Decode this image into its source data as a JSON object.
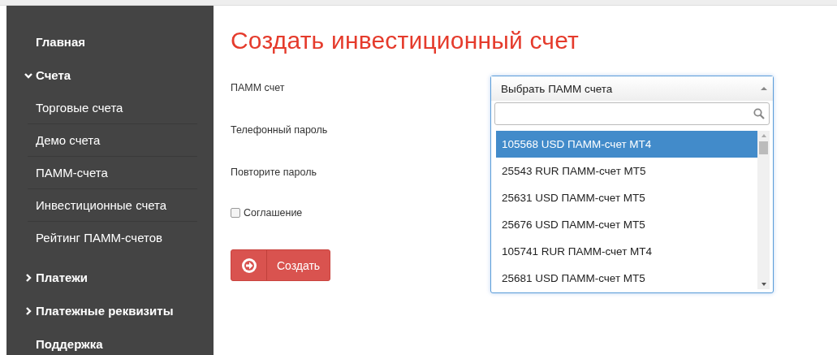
{
  "sidebar": {
    "items": [
      {
        "label": "Главная",
        "bold": true
      },
      {
        "label": "Счета",
        "bold": true,
        "expanded": true,
        "children": [
          {
            "label": "Торговые счета"
          },
          {
            "label": "Демо счета"
          },
          {
            "label": "ПАММ-счета"
          },
          {
            "label": "Инвестиционные счета"
          },
          {
            "label": "Рейтинг ПАММ-счетов"
          }
        ]
      },
      {
        "label": "Платежи",
        "bold": true,
        "expanded": false
      },
      {
        "label": "Платежные реквизиты",
        "bold": true,
        "expanded": false
      },
      {
        "label": "Поддержка",
        "bold": true
      }
    ]
  },
  "form": {
    "title": "Создать инвестиционный счет",
    "fields": [
      {
        "label": "ПАММ счет"
      },
      {
        "label": "Телефонный пароль"
      },
      {
        "label": "Повторите пароль"
      }
    ],
    "agreement": {
      "label": "Соглашение",
      "checked": false
    },
    "submit": "Создать",
    "dropdown": {
      "value": "Выбрать ПАММ счета",
      "expanded": true,
      "options": [
        {
          "label": "105568 USD ПАММ-счет MT4",
          "selected": true
        },
        {
          "label": "25543 RUR ПАММ-счет MT5",
          "selected": false
        },
        {
          "label": "25631 USD ПАММ-счет MT5",
          "selected": false
        },
        {
          "label": "25676 USD ПАММ-счет MT5",
          "selected": false
        },
        {
          "label": "105741 RUR ПАММ-счет MT4",
          "selected": false
        },
        {
          "label": "25681 USD ПАММ-счет MT5",
          "selected": false
        }
      ]
    }
  }
}
